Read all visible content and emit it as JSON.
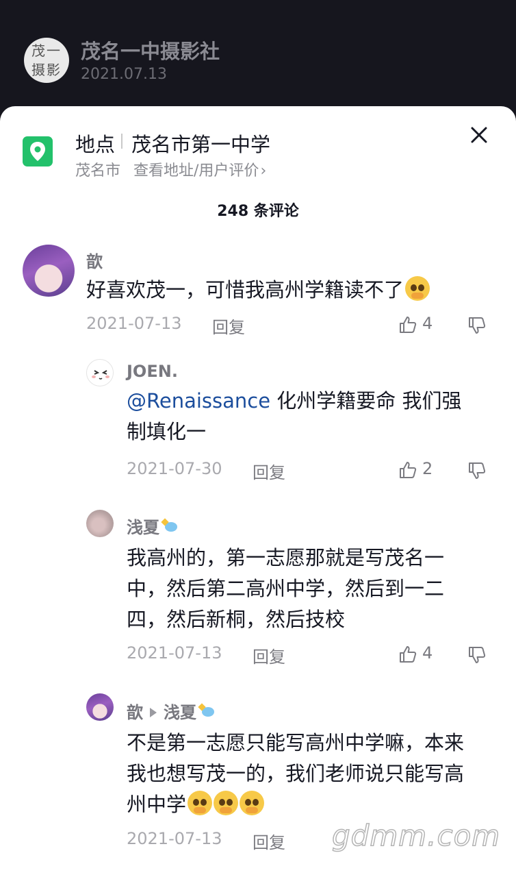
{
  "header": {
    "club_avatar_line1": "茂一",
    "club_avatar_line2": "摄影",
    "club_name": "茂名一中摄影社",
    "date": "2021.07.13"
  },
  "location": {
    "label": "地点",
    "name": "茂名市第一中学",
    "city": "茂名市",
    "link": "查看地址/用户评价",
    "icon": "map-pin-icon",
    "icon_color": "#23c16b"
  },
  "comments_count_title": "248 条评论",
  "comments": [
    {
      "user": "歆",
      "text": "好喜欢茂一，可惜我高州学籍读不了",
      "date": "2021-07-13",
      "reply": "回复",
      "likes": "4"
    },
    {
      "user": "JOEN.",
      "mention": "@Renaissance",
      "text_line1": " 化州学籍要命 我们强",
      "text_line2": "制填化一",
      "date": "2021-07-30",
      "reply": "回复",
      "likes": "2"
    },
    {
      "user": "浅夏",
      "text_line1": "我高州的，第一志愿那就是写茂名一",
      "text_line2": "中，然后第二高州中学，然后到一二",
      "text_line3": "四，然后新桐，然后技校",
      "date": "2021-07-13",
      "reply": "回复",
      "likes": "4"
    },
    {
      "user": "歆",
      "reply_to": "浅夏",
      "text_line1": "不是第一志愿只能写高州中学嘛，本来",
      "text_line2": "我也想写茂一的，我们老师说只能写高",
      "text_line3": "州中学",
      "date": "2021-07-13",
      "reply": "回复"
    }
  ],
  "watermark": "gdmm.com"
}
